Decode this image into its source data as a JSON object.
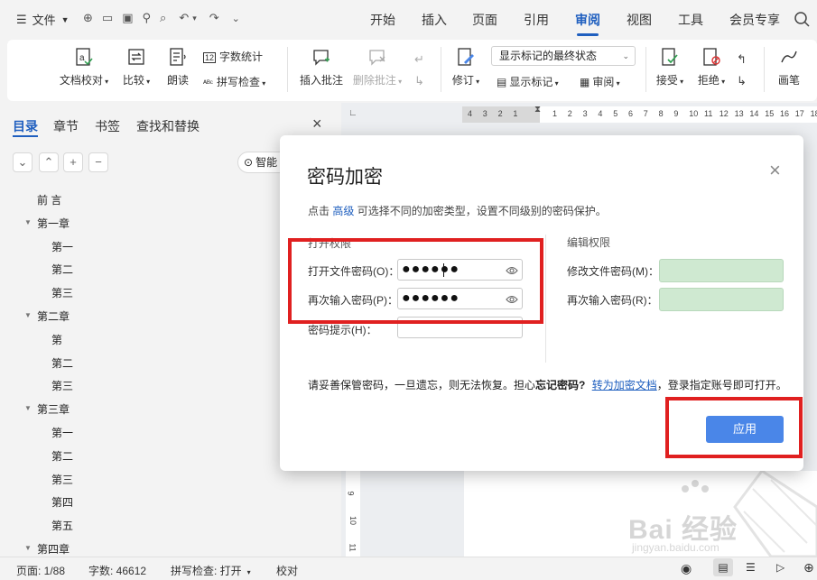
{
  "topbar": {
    "file_label": "文件",
    "tabs": [
      "开始",
      "插入",
      "页面",
      "引用",
      "审阅",
      "视图",
      "工具",
      "会员专享"
    ],
    "active_tab": "审阅"
  },
  "ribbon": {
    "doc_proofread": "文档校对",
    "compare": "比较",
    "read_aloud": "朗读",
    "word_count": "字数统计",
    "spell_check": "拼写检查",
    "insert_comment": "插入批注",
    "delete_comment": "删除批注",
    "revise": "修订",
    "markup_state": "显示标记的最终状态",
    "show_markup": "显示标记",
    "review": "审阅",
    "accept": "接受",
    "reject": "拒绝",
    "pen": "画笔"
  },
  "sidebar": {
    "tabs": [
      "目录",
      "章节",
      "书签",
      "查找和替换"
    ],
    "active_tab": "目录",
    "smart_label": "智能",
    "toc": [
      {
        "text": "前  言",
        "level": 0,
        "arrow": false
      },
      {
        "text": "第一章",
        "level": 0,
        "arrow": true
      },
      {
        "text": "第一",
        "level": 1,
        "arrow": false
      },
      {
        "text": "第二",
        "level": 1,
        "arrow": false
      },
      {
        "text": "第三",
        "level": 1,
        "arrow": false
      },
      {
        "text": "第二章",
        "level": 0,
        "arrow": true
      },
      {
        "text": "第",
        "level": 1,
        "arrow": false
      },
      {
        "text": "第二",
        "level": 1,
        "arrow": false
      },
      {
        "text": "第三",
        "level": 1,
        "arrow": false
      },
      {
        "text": "第三章",
        "level": 0,
        "arrow": true
      },
      {
        "text": "第一",
        "level": 1,
        "arrow": false
      },
      {
        "text": "第二",
        "level": 1,
        "arrow": false
      },
      {
        "text": "第三",
        "level": 1,
        "arrow": false
      },
      {
        "text": "第四",
        "level": 1,
        "arrow": false
      },
      {
        "text": "第五",
        "level": 1,
        "arrow": false
      },
      {
        "text": "第四章",
        "level": 0,
        "arrow": true
      }
    ]
  },
  "ruler": {
    "left_numbers": [
      "4",
      "3",
      "2",
      "1"
    ],
    "right_numbers": [
      "1",
      "2",
      "3",
      "4",
      "5",
      "6",
      "7",
      "8",
      "9",
      "10",
      "11",
      "12",
      "13",
      "14",
      "15",
      "16",
      "17",
      "18"
    ],
    "vertical_numbers": [
      "9",
      "10",
      "11"
    ]
  },
  "dialog": {
    "title": "密码加密",
    "hint_prefix": "点击",
    "hint_link": "高级",
    "hint_suffix": "可选择不同的加密类型，设置不同级别的密码保护。",
    "open_section": "打开权限",
    "edit_section": "编辑权限",
    "open_password_label": "打开文件密码(O)：",
    "open_password_value": "●●●●●●",
    "reenter_label": "再次输入密码(P)：",
    "reenter_value": "●●●●●●",
    "hint_field_label": "密码提示(H)：",
    "modify_password_label": "修改文件密码(M)：",
    "modify_reenter_label": "再次输入密码(R)：",
    "warning_text": "请妥善保管密码，一旦遗忘，则无法恢复。担心",
    "forgot_text": "忘记密码?",
    "convert_link": "转为加密文档",
    "warning_tail": "，登录指定账号即可打开。",
    "apply_button": "应用"
  },
  "statusbar": {
    "page": "页面: 1/88",
    "words": "字数: 46612",
    "spell": "拼写检查: 打开",
    "proof": "校对"
  },
  "watermark": {
    "text": "Bai 经验",
    "url": "jingyan.baidu.com"
  },
  "colors": {
    "accent": "#1f5fbf",
    "apply_button": "#4a86e8",
    "highlight_red": "#e02020",
    "green_field": "#cfe9d1"
  }
}
